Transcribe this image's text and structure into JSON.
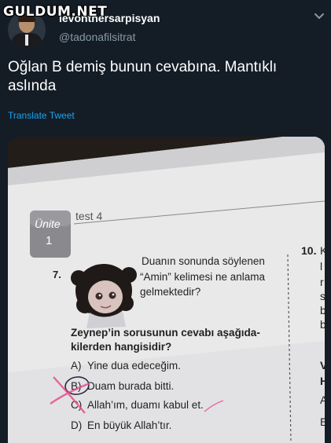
{
  "watermark": "GULDUM.NET",
  "tweet": {
    "display_name": "levonthersarpisyan",
    "handle": "@tadonafilsitrat",
    "text": "Oğlan B demiş bunun cevabına. Mantıklı aslında",
    "translate_label": "Translate Tweet",
    "icons": {
      "menu": "chevron-down-icon"
    }
  },
  "photo": {
    "test_label": "test 4",
    "unit_word": "Ünite",
    "unit_number": "1",
    "question_number": "7.",
    "speech_lines": [
      "Duanın sonunda söylenen",
      "“Amin” kelimesi ne anlama",
      "gelmektedir?"
    ],
    "prompt_lines": [
      "Zeynep’in sorusunun cevabı aşağıda-",
      "kilerden hangisidir?"
    ],
    "options": [
      {
        "letter": "A)",
        "text": "Yine dua edeceğim."
      },
      {
        "letter": "B)",
        "text": "Duam burada bitti."
      },
      {
        "letter": "C)",
        "text": "Allah’ım, duamı kabul et."
      },
      {
        "letter": "D)",
        "text": "En büyük Allah’tır."
      }
    ],
    "next_question_number": "10.",
    "next_column_fragments": [
      "K",
      "l",
      "r",
      "s",
      "b",
      "b",
      "V",
      "H",
      "A",
      "E"
    ]
  }
}
